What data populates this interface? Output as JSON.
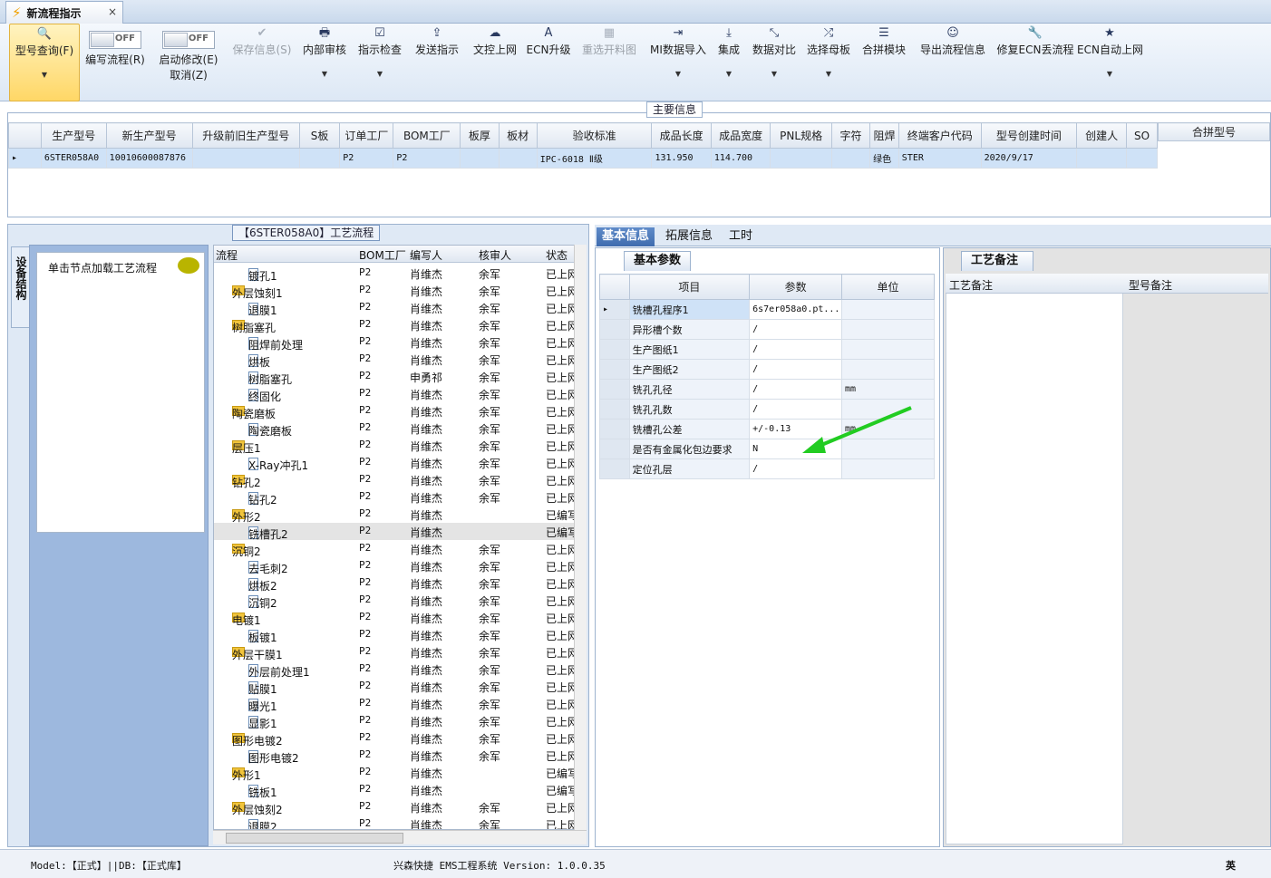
{
  "tab": {
    "title": "新流程指示",
    "close": "×"
  },
  "toolbar": [
    {
      "key": "query",
      "label": "型号查询(F)",
      "icon": "🔍",
      "active": true,
      "dropdown": true
    },
    {
      "key": "write",
      "label": "编写流程(R)",
      "toggle": "OFF"
    },
    {
      "key": "auto",
      "label": "启动修改(E)",
      "label2": "取消(Z)",
      "toggle": "OFF"
    },
    {
      "key": "save",
      "label": "保存信息(S)",
      "icon": "✔",
      "disabled": true
    },
    {
      "key": "review",
      "label": "内部审核",
      "icon": "🖶",
      "dropdown": true
    },
    {
      "key": "check",
      "label": "指示检查",
      "icon": "☑",
      "dropdown": true
    },
    {
      "key": "send",
      "label": "发送指示",
      "icon": "⇪"
    },
    {
      "key": "upload",
      "label": "文控上网",
      "icon": "☁"
    },
    {
      "key": "ecn",
      "label": "ECN升级",
      "icon": "A"
    },
    {
      "key": "reselect",
      "label": "重选开料图",
      "icon": "▦",
      "disabled": true
    },
    {
      "key": "mi",
      "label": "MI数据导入",
      "icon": "⇥",
      "dropdown": true
    },
    {
      "key": "integrate",
      "label": "集成",
      "icon": "⤓",
      "dropdown": true
    },
    {
      "key": "compare",
      "label": "数据对比",
      "icon": "⤡",
      "dropdown": true
    },
    {
      "key": "mother",
      "label": "选择母板",
      "icon": "⤮",
      "dropdown": true
    },
    {
      "key": "merge",
      "label": "合拼模块",
      "icon": "☰"
    },
    {
      "key": "export",
      "label": "导出流程信息",
      "icon": "☺"
    },
    {
      "key": "fix",
      "label": "修复ECN丢流程",
      "icon": "🔧"
    },
    {
      "key": "autoup",
      "label": "ECN自动上网",
      "icon": "★",
      "dropdown": true
    }
  ],
  "main_info": {
    "title": "主要信息",
    "columns": [
      "生产型号",
      "新生产型号",
      "升级前旧生产型号",
      "S板",
      "订单工厂",
      "BOM工厂",
      "板厚",
      "板材",
      "验收标准",
      "成品长度",
      "成品宽度",
      "PNL规格",
      "字符",
      "阻焊",
      "终端客户代码",
      "型号创建时间",
      "创建人",
      "SO"
    ],
    "row": [
      "6STER058A0",
      "10010600087876",
      "",
      "",
      "P2",
      "P2",
      "",
      "",
      "IPC-6018 Ⅱ级",
      "131.950",
      "114.700",
      "",
      "",
      "绿色",
      "STER",
      "2020/9/17",
      "",
      ""
    ],
    "merge_header": "合拼型号"
  },
  "side": {
    "vertical_tab": "设备结构",
    "hint": "单击节点加载工艺流程"
  },
  "process": {
    "title": "【6STER058A0】工艺流程",
    "columns": [
      "流程",
      "BOM工厂",
      "编写人",
      "核审人",
      "状态"
    ],
    "rows": [
      {
        "name": "镀孔1",
        "level": 2,
        "type": "doc",
        "bom": "P2",
        "writer": "肖维杰",
        "reviewer": "余军",
        "status": "已上网"
      },
      {
        "name": "外层蚀刻1",
        "level": 1,
        "type": "folder",
        "bom": "P2",
        "writer": "肖维杰",
        "reviewer": "余军",
        "status": "已上网"
      },
      {
        "name": "退膜1",
        "level": 2,
        "type": "doc",
        "bom": "P2",
        "writer": "肖维杰",
        "reviewer": "余军",
        "status": "已上网"
      },
      {
        "name": "树脂塞孔",
        "level": 1,
        "type": "folder",
        "bom": "P2",
        "writer": "肖维杰",
        "reviewer": "余军",
        "status": "已上网"
      },
      {
        "name": "阻焊前处理",
        "level": 2,
        "type": "doc",
        "bom": "P2",
        "writer": "肖维杰",
        "reviewer": "余军",
        "status": "已上网"
      },
      {
        "name": "烘板",
        "level": 2,
        "type": "doc",
        "bom": "P2",
        "writer": "肖维杰",
        "reviewer": "余军",
        "status": "已上网"
      },
      {
        "name": "树脂塞孔",
        "level": 2,
        "type": "doc",
        "bom": "P2",
        "writer": "申勇祁",
        "reviewer": "余军",
        "status": "已上网"
      },
      {
        "name": "终固化",
        "level": 2,
        "type": "doc",
        "bom": "P2",
        "writer": "肖维杰",
        "reviewer": "余军",
        "status": "已上网"
      },
      {
        "name": "陶瓷磨板",
        "level": 1,
        "type": "folder",
        "bom": "P2",
        "writer": "肖维杰",
        "reviewer": "余军",
        "status": "已上网"
      },
      {
        "name": "陶瓷磨板",
        "level": 2,
        "type": "doc",
        "bom": "P2",
        "writer": "肖维杰",
        "reviewer": "余军",
        "status": "已上网"
      },
      {
        "name": "层压1",
        "level": 1,
        "type": "folder",
        "bom": "P2",
        "writer": "肖维杰",
        "reviewer": "余军",
        "status": "已上网"
      },
      {
        "name": "X-Ray冲孔1",
        "level": 2,
        "type": "doc",
        "bom": "P2",
        "writer": "肖维杰",
        "reviewer": "余军",
        "status": "已上网"
      },
      {
        "name": "钻孔2",
        "level": 1,
        "type": "folder",
        "bom": "P2",
        "writer": "肖维杰",
        "reviewer": "余军",
        "status": "已上网"
      },
      {
        "name": "钻孔2",
        "level": 2,
        "type": "doc",
        "bom": "P2",
        "writer": "肖维杰",
        "reviewer": "余军",
        "status": "已上网"
      },
      {
        "name": "外形2",
        "level": 1,
        "type": "folder",
        "bom": "P2",
        "writer": "肖维杰",
        "reviewer": "",
        "status": "已编写"
      },
      {
        "name": "铣槽孔2",
        "level": 2,
        "type": "doc",
        "bom": "P2",
        "writer": "肖维杰",
        "reviewer": "",
        "status": "已编写",
        "selected": true
      },
      {
        "name": "沉铜2",
        "level": 1,
        "type": "folder",
        "bom": "P2",
        "writer": "肖维杰",
        "reviewer": "余军",
        "status": "已上网"
      },
      {
        "name": "去毛刺2",
        "level": 2,
        "type": "doc",
        "bom": "P2",
        "writer": "肖维杰",
        "reviewer": "余军",
        "status": "已上网"
      },
      {
        "name": "烘板2",
        "level": 2,
        "type": "doc",
        "bom": "P2",
        "writer": "肖维杰",
        "reviewer": "余军",
        "status": "已上网"
      },
      {
        "name": "沉铜2",
        "level": 2,
        "type": "doc",
        "bom": "P2",
        "writer": "肖维杰",
        "reviewer": "余军",
        "status": "已上网"
      },
      {
        "name": "电镀1",
        "level": 1,
        "type": "folder",
        "bom": "P2",
        "writer": "肖维杰",
        "reviewer": "余军",
        "status": "已上网"
      },
      {
        "name": "板镀1",
        "level": 2,
        "type": "doc",
        "bom": "P2",
        "writer": "肖维杰",
        "reviewer": "余军",
        "status": "已上网"
      },
      {
        "name": "外层干膜1",
        "level": 1,
        "type": "folder",
        "bom": "P2",
        "writer": "肖维杰",
        "reviewer": "余军",
        "status": "已上网"
      },
      {
        "name": "外层前处理1",
        "level": 2,
        "type": "doc",
        "bom": "P2",
        "writer": "肖维杰",
        "reviewer": "余军",
        "status": "已上网"
      },
      {
        "name": "贴膜1",
        "level": 2,
        "type": "doc",
        "bom": "P2",
        "writer": "肖维杰",
        "reviewer": "余军",
        "status": "已上网"
      },
      {
        "name": "曝光1",
        "level": 2,
        "type": "doc",
        "bom": "P2",
        "writer": "肖维杰",
        "reviewer": "余军",
        "status": "已上网"
      },
      {
        "name": "显影1",
        "level": 2,
        "type": "doc",
        "bom": "P2",
        "writer": "肖维杰",
        "reviewer": "余军",
        "status": "已上网"
      },
      {
        "name": "图形电镀2",
        "level": 1,
        "type": "folder",
        "bom": "P2",
        "writer": "肖维杰",
        "reviewer": "余军",
        "status": "已上网"
      },
      {
        "name": "图形电镀2",
        "level": 2,
        "type": "doc",
        "bom": "P2",
        "writer": "肖维杰",
        "reviewer": "余军",
        "status": "已上网"
      },
      {
        "name": "外形1",
        "level": 1,
        "type": "folder",
        "bom": "P2",
        "writer": "肖维杰",
        "reviewer": "",
        "status": "已编写"
      },
      {
        "name": "铣板1",
        "level": 2,
        "type": "doc",
        "bom": "P2",
        "writer": "肖维杰",
        "reviewer": "",
        "status": "已编写"
      },
      {
        "name": "外层蚀刻2",
        "level": 1,
        "type": "folder",
        "bom": "P2",
        "writer": "肖维杰",
        "reviewer": "余军",
        "status": "已上网"
      },
      {
        "name": "退膜2",
        "level": 2,
        "type": "doc",
        "bom": "P2",
        "writer": "肖维杰",
        "reviewer": "余军",
        "status": "已上网"
      }
    ]
  },
  "right_tabs": [
    "基本信息",
    "拓展信息",
    "工时"
  ],
  "basic": {
    "subtab": "基本参数",
    "columns": [
      "项目",
      "参数",
      "单位"
    ],
    "rows": [
      {
        "item": "铣槽孔程序1",
        "param": "6s7er058a0.pt...",
        "unit": ""
      },
      {
        "item": "异形槽个数",
        "param": "/",
        "unit": ""
      },
      {
        "item": "生产图纸1",
        "param": "/",
        "unit": ""
      },
      {
        "item": "生产图纸2",
        "param": "/",
        "unit": ""
      },
      {
        "item": "铣孔孔径",
        "param": "/",
        "unit": "mm"
      },
      {
        "item": "铣孔孔数",
        "param": "/",
        "unit": ""
      },
      {
        "item": "铣槽孔公差",
        "param": "+/-0.13",
        "unit": "mm"
      },
      {
        "item": "是否有金属化包边要求",
        "param": "N",
        "unit": ""
      },
      {
        "item": "定位孔层",
        "param": "/",
        "unit": ""
      }
    ]
  },
  "notes": {
    "subtab": "工艺备注",
    "columns": [
      "工艺备注",
      "型号备注"
    ]
  },
  "status": {
    "left": "Model:【正式】||DB:【正式库】",
    "center": "兴森快捷 EMS工程系统 Version: 1.0.0.35",
    "ime": "英"
  },
  "colors": {
    "accent": "#3f6cae",
    "selected_row": "#cfe2f7",
    "arrow": "#22cc22"
  }
}
